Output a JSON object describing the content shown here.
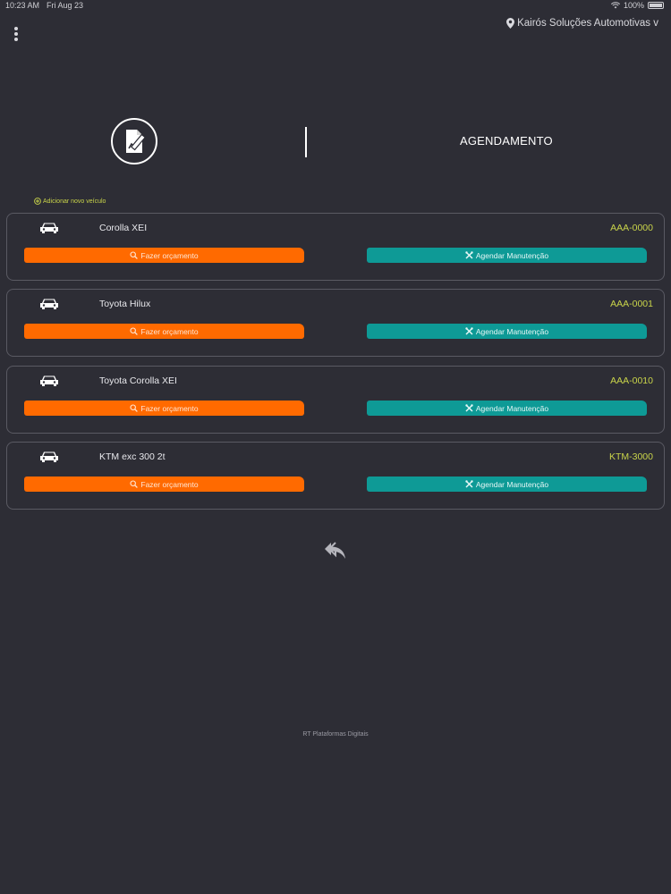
{
  "status_bar": {
    "time": "10:23 AM",
    "date": "Fri Aug 23",
    "battery": "100%"
  },
  "top_bar": {
    "location": "Kairós Soluções Automotivas v"
  },
  "header": {
    "title": "AGENDAMENTO"
  },
  "add_vehicle_label": "Adicionar novo veículo",
  "vehicles": [
    {
      "model": "Corolla XEI",
      "plate": "AAA-0000",
      "quote_label": "Fazer orçamento",
      "schedule_label": "Agendar Manutenção"
    },
    {
      "model": "Toyota Hilux",
      "plate": "AAA-0001",
      "quote_label": "Fazer orçamento",
      "schedule_label": "Agendar Manutenção"
    },
    {
      "model": "Toyota Corolla XEI",
      "plate": "AAA-0010",
      "quote_label": "Fazer orçamento",
      "schedule_label": "Agendar Manutenção"
    },
    {
      "model": "KTM exc 300 2t",
      "plate": "KTM-3000",
      "quote_label": "Fazer orçamento",
      "schedule_label": "Agendar Manutenção"
    }
  ],
  "footer": "RT Plataformas Digitais",
  "colors": {
    "background": "#2d2d35",
    "accent_orange": "#ff6a00",
    "accent_teal": "#0e9a96",
    "plate_text": "#c9d44a"
  },
  "icons": [
    "menu-dots-icon",
    "location-pin-icon",
    "document-edit-icon",
    "add-circle-icon",
    "car-icon",
    "search-icon",
    "tools-icon",
    "back-reply-icon"
  ]
}
